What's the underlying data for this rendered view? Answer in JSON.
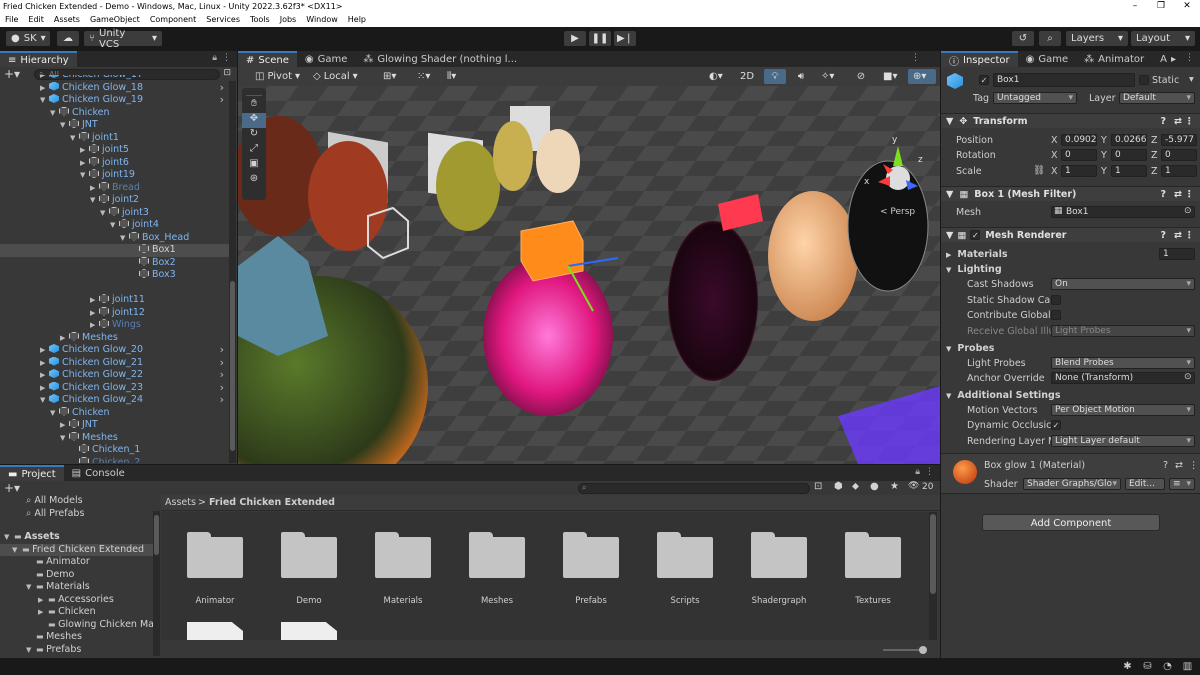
{
  "window": {
    "title": "Fried Chicken Extended - Demo - Windows, Mac, Linux - Unity 2022.3.62f3* <DX11>"
  },
  "menu": [
    "File",
    "Edit",
    "Assets",
    "GameObject",
    "Component",
    "Services",
    "Tools",
    "Jobs",
    "Window",
    "Help"
  ],
  "toolbar": {
    "account": "SK",
    "vcs": "Unity VCS",
    "layers": "Layers",
    "layout": "Layout"
  },
  "hierarchy": {
    "tab": "Hierarchy",
    "search_placeholder": "All",
    "rows": [
      {
        "text": "Chicken Glow_17",
        "indent": 4,
        "arrow": "▶",
        "icon": "blue",
        "cls": "blue",
        "y": 0
      },
      {
        "text": "Chicken Glow_18",
        "indent": 4,
        "arrow": "▶",
        "icon": "blue",
        "cls": "blue",
        "chev": true
      },
      {
        "text": "Chicken Glow_19",
        "indent": 4,
        "arrow": "▼",
        "icon": "blue",
        "cls": "blue",
        "chev": true
      },
      {
        "text": "Chicken",
        "indent": 5,
        "arrow": "▼",
        "icon": "gray",
        "cls": "blue"
      },
      {
        "text": "JNT",
        "indent": 6,
        "arrow": "▼",
        "icon": "gray",
        "cls": "blue"
      },
      {
        "text": "joint1",
        "indent": 7,
        "arrow": "▼",
        "icon": "gray",
        "cls": "blue"
      },
      {
        "text": "joint5",
        "indent": 8,
        "arrow": "▶",
        "icon": "gray",
        "cls": "blue"
      },
      {
        "text": "joint6",
        "indent": 8,
        "arrow": "▶",
        "icon": "gray",
        "cls": "blue"
      },
      {
        "text": "joint19",
        "indent": 8,
        "arrow": "▼",
        "icon": "gray",
        "cls": "blue"
      },
      {
        "text": "Bread",
        "indent": 9,
        "arrow": "▶",
        "icon": "gray",
        "cls": "dim"
      },
      {
        "text": "joint2",
        "indent": 9,
        "arrow": "▼",
        "icon": "gray",
        "cls": "blue"
      },
      {
        "text": "joint3",
        "indent": 10,
        "arrow": "▼",
        "icon": "gray",
        "cls": "blue"
      },
      {
        "text": "joint4",
        "indent": 11,
        "arrow": "▼",
        "icon": "gray",
        "cls": "blue"
      },
      {
        "text": "Box_Head",
        "indent": 12,
        "arrow": "▼",
        "icon": "gray",
        "cls": "blue"
      },
      {
        "text": "Box1",
        "indent": 13,
        "arrow": "",
        "icon": "gray",
        "cls": "",
        "sel": true
      },
      {
        "text": "Box2",
        "indent": 13,
        "arrow": "",
        "icon": "gray",
        "cls": "blue"
      },
      {
        "text": "Box3",
        "indent": 13,
        "arrow": "",
        "icon": "gray",
        "cls": "blue"
      },
      {
        "text": "",
        "indent": 0,
        "arrow": "",
        "icon": "",
        "cls": ""
      },
      {
        "text": "joint11",
        "indent": 9,
        "arrow": "▶",
        "icon": "gray",
        "cls": "blue"
      },
      {
        "text": "joint12",
        "indent": 9,
        "arrow": "▶",
        "icon": "gray",
        "cls": "blue"
      },
      {
        "text": "Wings",
        "indent": 9,
        "arrow": "▶",
        "icon": "gray",
        "cls": "dim"
      },
      {
        "text": "Meshes",
        "indent": 6,
        "arrow": "▶",
        "icon": "gray",
        "cls": "blue"
      },
      {
        "text": "Chicken Glow_20",
        "indent": 4,
        "arrow": "▶",
        "icon": "blue",
        "cls": "blue",
        "chev": true
      },
      {
        "text": "Chicken Glow_21",
        "indent": 4,
        "arrow": "▶",
        "icon": "blue",
        "cls": "blue",
        "chev": true
      },
      {
        "text": "Chicken Glow_22",
        "indent": 4,
        "arrow": "▶",
        "icon": "blue",
        "cls": "blue",
        "chev": true
      },
      {
        "text": "Chicken Glow_23",
        "indent": 4,
        "arrow": "▶",
        "icon": "blue",
        "cls": "blue",
        "chev": true
      },
      {
        "text": "Chicken Glow_24",
        "indent": 4,
        "arrow": "▼",
        "icon": "blue",
        "cls": "blue",
        "chev": true
      },
      {
        "text": "Chicken",
        "indent": 5,
        "arrow": "▼",
        "icon": "gray",
        "cls": "blue"
      },
      {
        "text": "JNT",
        "indent": 6,
        "arrow": "▶",
        "icon": "gray",
        "cls": "blue"
      },
      {
        "text": "Meshes",
        "indent": 6,
        "arrow": "▼",
        "icon": "gray",
        "cls": "blue"
      },
      {
        "text": "Chicken_1",
        "indent": 7,
        "arrow": "",
        "icon": "gray",
        "cls": "blue"
      },
      {
        "text": "Chicken_2",
        "indent": 7,
        "arrow": "",
        "icon": "gray",
        "cls": "dim"
      }
    ]
  },
  "scene": {
    "tabs": [
      "Scene",
      "Game",
      "Glowing Shader (nothing l..."
    ],
    "pivot": "Pivot",
    "space": "Local",
    "mode2d": "2D",
    "persp": "< Persp",
    "gizmo_axes": {
      "x": "x",
      "y": "y",
      "z": "z"
    }
  },
  "inspector": {
    "tabs": [
      "Inspector",
      "Game",
      "Animator",
      "A"
    ],
    "object_name": "Box1",
    "static_label": "Static",
    "tag_label": "Tag",
    "tag": "Untagged",
    "layer_label": "Layer",
    "layer": "Default",
    "transform": {
      "title": "Transform",
      "position_label": "Position",
      "rotation_label": "Rotation",
      "scale_label": "Scale",
      "position": {
        "x": "0.0902",
        "y": "0.0266",
        "z": "-5.977"
      },
      "rotation": {
        "x": "0",
        "y": "0",
        "z": "0"
      },
      "scale": {
        "x": "1",
        "y": "1",
        "z": "1"
      }
    },
    "mesh_filter": {
      "title": "Box 1 (Mesh Filter)",
      "mesh_label": "Mesh",
      "mesh": "Box1"
    },
    "mesh_renderer": {
      "title": "Mesh Renderer",
      "materials_label": "Materials",
      "materials_count": "1",
      "lighting_label": "Lighting",
      "cast_shadows_label": "Cast Shadows",
      "cast_shadows": "On",
      "static_shadow_label": "Static Shadow Ca",
      "contribute_gi_label": "Contribute Global",
      "receive_gi_label": "Receive Global Illu",
      "receive_gi": "Light Probes",
      "probes_label": "Probes",
      "light_probes_label": "Light Probes",
      "light_probes": "Blend Probes",
      "anchor_label": "Anchor Override",
      "anchor": "None (Transform)",
      "additional_label": "Additional Settings",
      "motion_label": "Motion Vectors",
      "motion": "Per Object Motion",
      "dynamic_label": "Dynamic Occlusic",
      "rendering_layer_label": "Rendering Layer M",
      "rendering_layer": "Light Layer default"
    },
    "material": {
      "title": "Box glow 1 (Material)",
      "shader_label": "Shader",
      "shader": "Shader Graphs/Glo",
      "edit": "Edit..."
    },
    "add_component": "Add Component"
  },
  "project": {
    "tabs": [
      "Project",
      "Console"
    ],
    "favorites": [
      "All Models",
      "All Prefabs"
    ],
    "tree": [
      {
        "text": "Assets",
        "x": 14,
        "arrow": "▼",
        "bold": true
      },
      {
        "text": "Fried Chicken Extended",
        "x": 22,
        "arrow": "▼",
        "sel": true
      },
      {
        "text": "Animator",
        "x": 36,
        "arrow": ""
      },
      {
        "text": "Demo",
        "x": 36,
        "arrow": ""
      },
      {
        "text": "Materials",
        "x": 36,
        "arrow": "▼"
      },
      {
        "text": "Accessories",
        "x": 48,
        "arrow": "▶"
      },
      {
        "text": "Chicken",
        "x": 48,
        "arrow": "▶"
      },
      {
        "text": "Glowing Chicken Ma",
        "x": 48,
        "arrow": ""
      },
      {
        "text": "Meshes",
        "x": 36,
        "arrow": ""
      },
      {
        "text": "Prefabs",
        "x": 36,
        "arrow": "▼"
      }
    ],
    "breadcrumb": {
      "root": "Assets",
      "sep": ">",
      "current": "Fried Chicken Extended"
    },
    "folders": [
      "Animator",
      "Demo",
      "Materials",
      "Meshes",
      "Prefabs",
      "Scripts",
      "Shadergraph",
      "Textures"
    ],
    "hidden_count": "20"
  }
}
